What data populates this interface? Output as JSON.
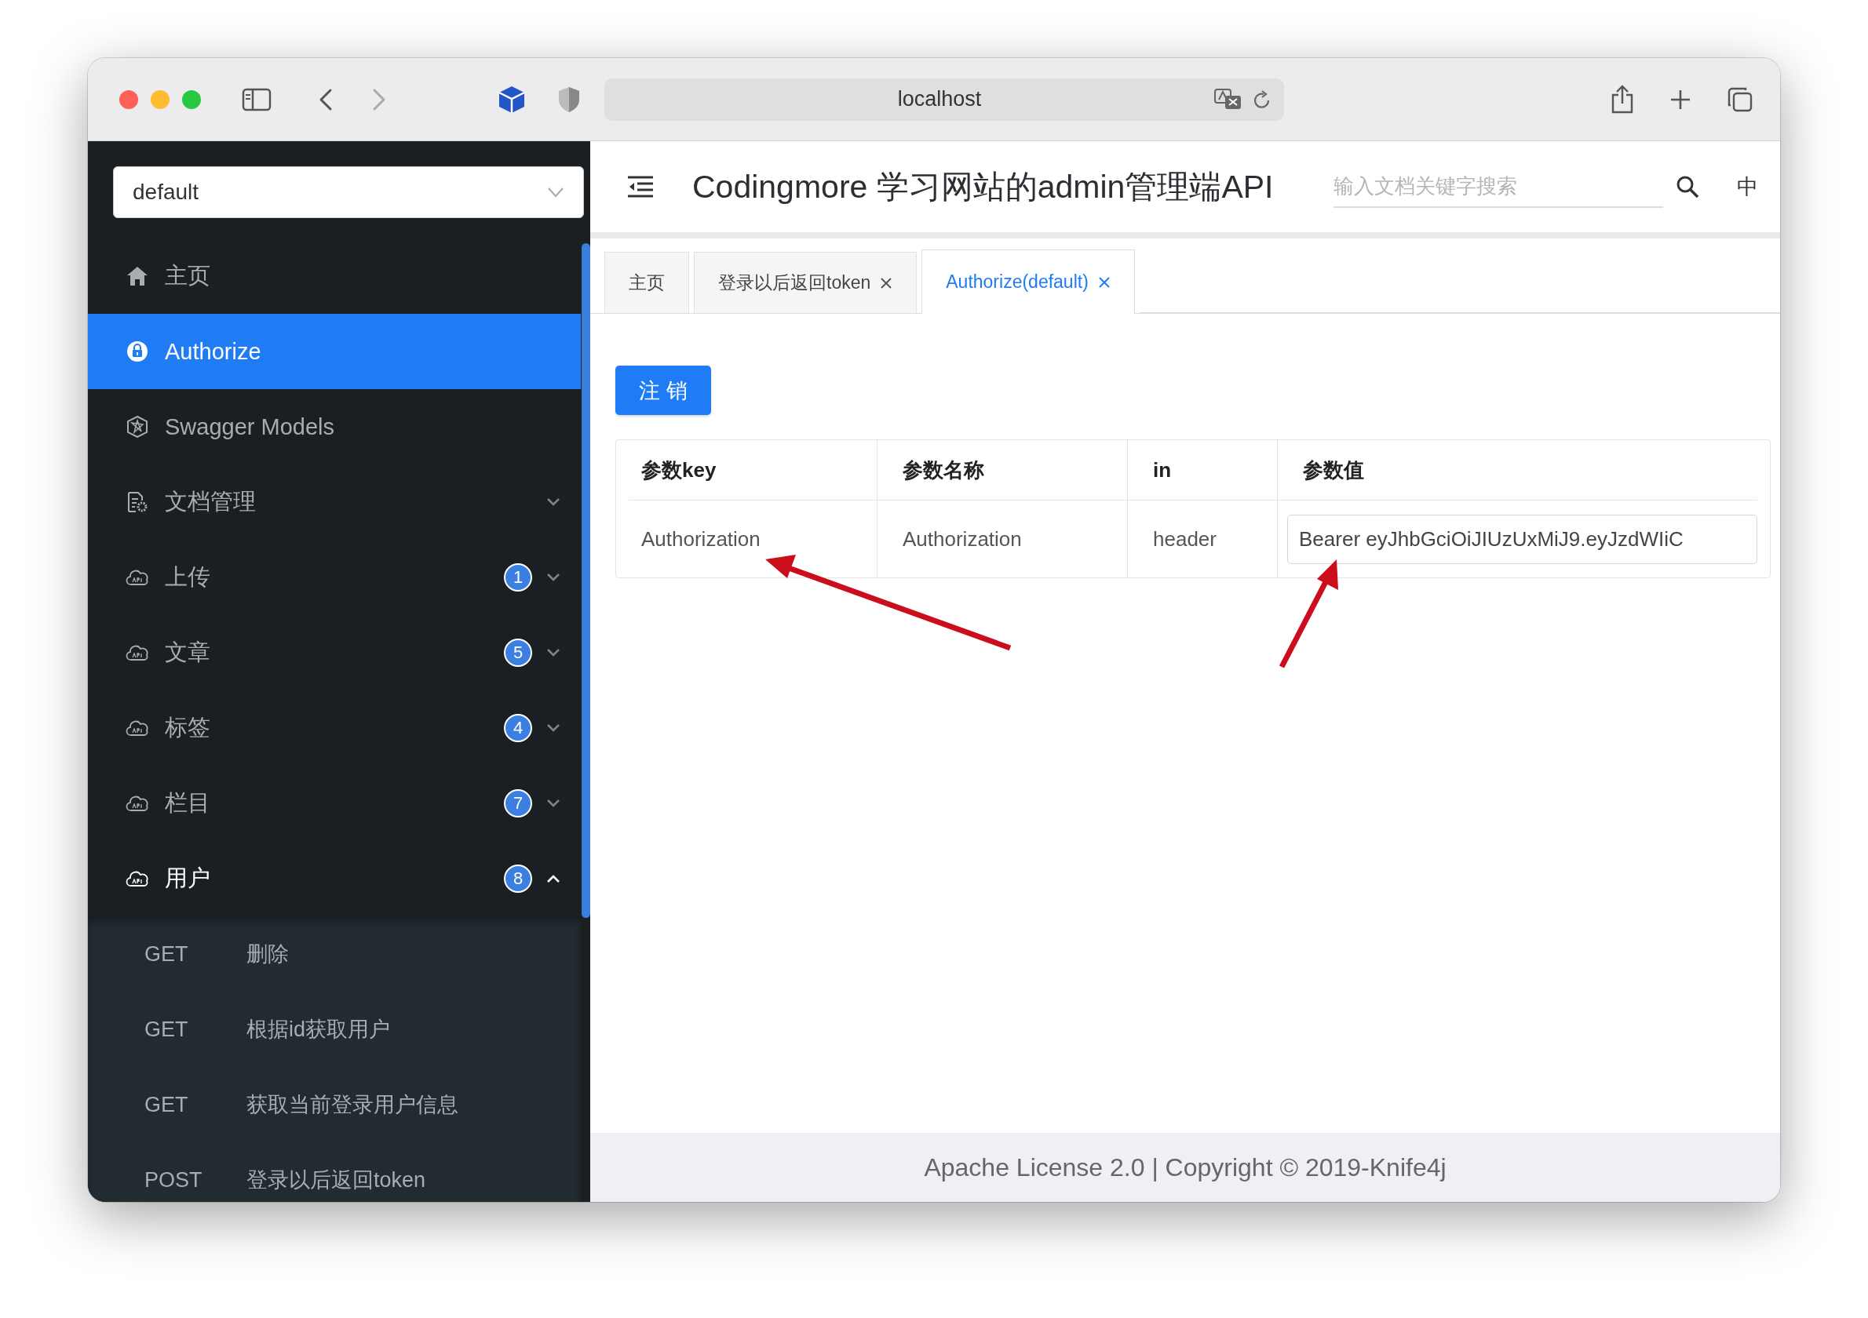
{
  "browser": {
    "url": "localhost"
  },
  "sidebar": {
    "group_select": "default",
    "items": [
      {
        "label": "主页",
        "kind": "home",
        "selected": false
      },
      {
        "label": "Authorize",
        "kind": "lock",
        "selected": true
      },
      {
        "label": "Swagger Models",
        "kind": "models",
        "selected": false
      },
      {
        "label": "文档管理",
        "kind": "docs",
        "selected": false,
        "expanded": false
      },
      {
        "label": "上传",
        "kind": "api",
        "selected": false,
        "badge": "1",
        "expanded": false
      },
      {
        "label": "文章",
        "kind": "api",
        "selected": false,
        "badge": "5",
        "expanded": false
      },
      {
        "label": "标签",
        "kind": "api",
        "selected": false,
        "badge": "4",
        "expanded": false
      },
      {
        "label": "栏目",
        "kind": "api",
        "selected": false,
        "badge": "7",
        "expanded": false
      },
      {
        "label": "用户",
        "kind": "api",
        "selected": false,
        "badge": "8",
        "expanded": true,
        "children": [
          {
            "method": "GET",
            "label": "删除"
          },
          {
            "method": "GET",
            "label": "根据id获取用户"
          },
          {
            "method": "GET",
            "label": "获取当前登录用户信息"
          },
          {
            "method": "POST",
            "label": "登录以后返回token"
          }
        ]
      }
    ]
  },
  "header": {
    "title": "Codingmore 学习网站的admin管理端API",
    "search_placeholder": "输入文档关键字搜索",
    "language": "中"
  },
  "tabs": [
    {
      "label": "主页",
      "closable": false,
      "selected": false
    },
    {
      "label": "登录以后返回token",
      "closable": true,
      "selected": false
    },
    {
      "label": "Authorize(default)",
      "closable": true,
      "selected": true
    }
  ],
  "logout_button": "注 销",
  "table": {
    "columns": [
      "参数key",
      "参数名称",
      "in",
      "参数值"
    ],
    "rows": [
      {
        "key": "Authorization",
        "name": "Authorization",
        "in": "header",
        "value": "Bearer eyJhbGciOiJIUzUxMiJ9.eyJzdWIiC"
      }
    ]
  },
  "footer": "Apache License 2.0 | Copyright © 2019-Knife4j"
}
